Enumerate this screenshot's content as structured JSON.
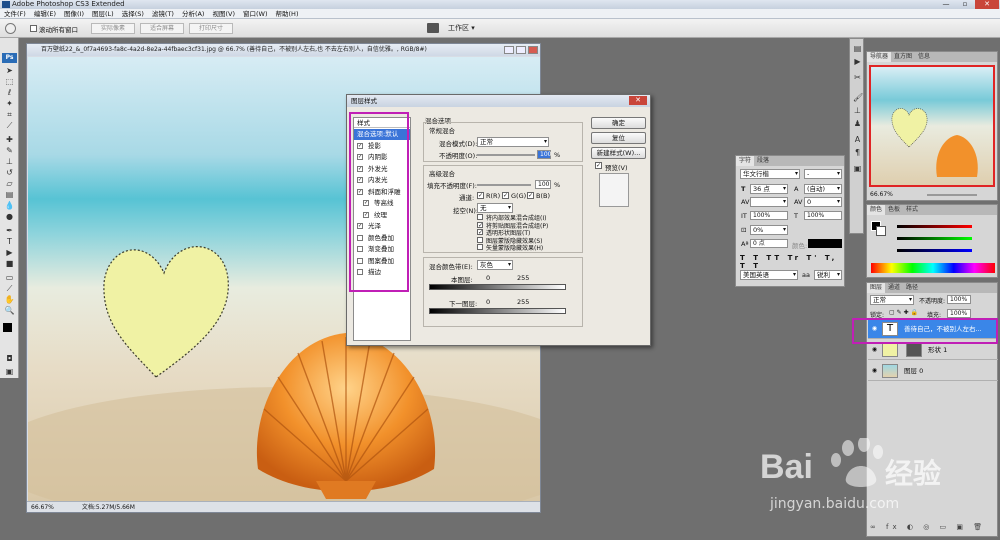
{
  "app": {
    "title": "Adobe Photoshop CS3 Extended"
  },
  "window_controls": {
    "minimize": "—",
    "restore": "▫",
    "close": "✕"
  },
  "menu": [
    "文件(F)",
    "编辑(E)",
    "图像(I)",
    "图层(L)",
    "选择(S)",
    "滤镜(T)",
    "分析(A)",
    "视图(V)",
    "窗口(W)",
    "帮助(H)"
  ],
  "options": {
    "scroll_all": "滚动所有窗口",
    "actual_pixels": "实际像素",
    "fit_screen": "适合屏幕",
    "print_size": "打印尺寸",
    "workspace": "工作区 ▾"
  },
  "tools": {
    "logo": "Ps"
  },
  "document": {
    "title": "百万壁纸22_&_0f7a4693-fa8c-4a2d-8e2a-44fbaec3cf31.jpg @ 66.7% (善待自己，不被别人左右,也    不去左右别人，自信优雅。, RGB/8#)",
    "zoom": "66.67%",
    "doc_size": "文档:5.27M/5.66M"
  },
  "dialog": {
    "title": "图层样式",
    "styles_header": "样式",
    "styles": [
      {
        "label": "混合选项:默认",
        "checked": null,
        "selected": true
      },
      {
        "label": "投影",
        "checked": true
      },
      {
        "label": "内阴影",
        "checked": true
      },
      {
        "label": "外发光",
        "checked": true
      },
      {
        "label": "内发光",
        "checked": true
      },
      {
        "label": "斜面和浮雕",
        "checked": true
      },
      {
        "label": "等高线",
        "checked": true,
        "sub": true
      },
      {
        "label": "纹理",
        "checked": true,
        "sub": true
      },
      {
        "label": "光泽",
        "checked": true
      },
      {
        "label": "颜色叠加",
        "checked": false
      },
      {
        "label": "渐变叠加",
        "checked": false
      },
      {
        "label": "图案叠加",
        "checked": false
      },
      {
        "label": "描边",
        "checked": false
      }
    ],
    "blend_options": "混合选项",
    "general_blending": "常规混合",
    "blend_mode_label": "混合模式(D):",
    "blend_mode": "正常",
    "opacity_label": "不透明度(O):",
    "opacity": "100",
    "percent": "%",
    "advanced_blending": "高级混合",
    "fill_opacity_label": "填充不透明度(F):",
    "fill_opacity": "100",
    "channels_label": "通道:",
    "channel_r": "R(R)",
    "channel_g": "G(G)",
    "channel_b": "B(B)",
    "knockout_label": "挖空(N):",
    "knockout": "无",
    "adv_options": [
      {
        "label": "将内部效果混合成组(I)",
        "checked": false
      },
      {
        "label": "将剪贴图层混合成组(P)",
        "checked": true
      },
      {
        "label": "透明形状图层(T)",
        "checked": true
      },
      {
        "label": "图层蒙版隐藏效果(S)",
        "checked": false
      },
      {
        "label": "矢量蒙版隐藏效果(H)",
        "checked": false
      }
    ],
    "blend_if_label": "混合颜色带(E):",
    "blend_if": "灰色",
    "this_layer": "本图层:",
    "underlying_layer": "下一图层:",
    "range_min": "0",
    "range_max": "255",
    "ok": "确定",
    "reset": "复位",
    "new_style": "新建样式(W)...",
    "preview": "预览(V)"
  },
  "navigator": {
    "tabs": [
      "导航器",
      "直方图",
      "信息"
    ],
    "zoom": "66.67%"
  },
  "character": {
    "tabs": [
      "字符",
      "段落"
    ],
    "font": "华文行楷",
    "style": "-",
    "size": "36 点",
    "leading": "(自动)",
    "tracking": "0",
    "vscale": "100%",
    "hscale": "100%",
    "kerning": "0%",
    "baseline": "0 点",
    "color_label": "颜色:",
    "language": "美国英语",
    "aa": "锐利"
  },
  "color_panel": {
    "tabs": [
      "颜色",
      "色板",
      "样式"
    ]
  },
  "layers": {
    "tabs": [
      "图层",
      "通道",
      "路径"
    ],
    "mode": "正常",
    "opacity_label": "不透明度:",
    "opacity": "100%",
    "lock_label": "锁定:",
    "fill_label": "填充:",
    "fill": "100%",
    "items": [
      {
        "name": "善待自己，不被别人左右...",
        "kind": "text",
        "selected": true
      },
      {
        "name": "形状 1",
        "kind": "shape",
        "selected": false
      },
      {
        "name": "图层 0",
        "kind": "image",
        "selected": false
      }
    ]
  },
  "watermark": {
    "brand": "Bai",
    "brand2": "经验",
    "url": "jingyan.baidu.com"
  }
}
